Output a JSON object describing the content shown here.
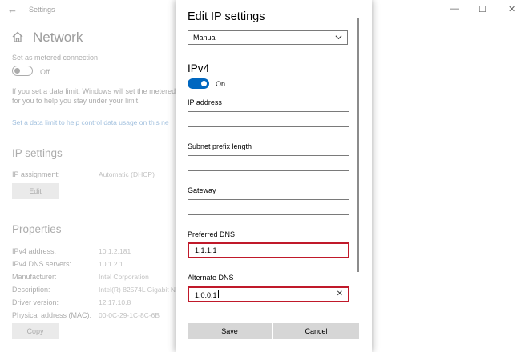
{
  "window": {
    "title": "Settings",
    "back_icon": "back-arrow-icon",
    "minimize": "—",
    "maximize": "☐",
    "close": "✕"
  },
  "page": {
    "title": "Network",
    "icon": "home-icon"
  },
  "metered": {
    "label": "Set as metered connection",
    "toggle_state": "Off",
    "description_line1": "If you set a data limit, Windows will set the metered",
    "description_line2": "for you to help you stay under your limit.",
    "link": "Set a data limit to help control data usage on this ne"
  },
  "ip_settings": {
    "title": "IP settings",
    "assignment_label": "IP assignment:",
    "assignment_value": "Automatic (DHCP)",
    "edit_button": "Edit"
  },
  "properties": {
    "title": "Properties",
    "rows": [
      {
        "label": "IPv4 address:",
        "value": "10.1.2.181"
      },
      {
        "label": "IPv4 DNS servers:",
        "value": "10.1.2.1"
      },
      {
        "label": "Manufacturer:",
        "value": "Intel Corporation"
      },
      {
        "label": "Description:",
        "value": "Intel(R) 82574L Gigabit N"
      },
      {
        "label": "Driver version:",
        "value": "12.17.10.8"
      },
      {
        "label": "Physical address (MAC):",
        "value": "00-0C-29-1C-8C-6B"
      }
    ],
    "copy_button": "Copy"
  },
  "dialog": {
    "title": "Edit IP settings",
    "mode_select": {
      "value": "Manual",
      "icon": "chevron-down-icon"
    },
    "section": "IPv4",
    "ipv4_toggle": {
      "state": "On",
      "on": true,
      "color": "#0067c0"
    },
    "fields": {
      "ip_address": {
        "label": "IP address",
        "value": ""
      },
      "subnet_prefix": {
        "label": "Subnet prefix length",
        "value": ""
      },
      "gateway": {
        "label": "Gateway",
        "value": ""
      },
      "preferred_dns": {
        "label": "Preferred DNS",
        "value": "1.1.1.1"
      },
      "alternate_dns": {
        "label": "Alternate DNS",
        "value": "1.0.0.1",
        "clear_icon": "✕"
      }
    },
    "highlight_color": "#c0192a",
    "save_button": "Save",
    "cancel_button": "Cancel"
  }
}
